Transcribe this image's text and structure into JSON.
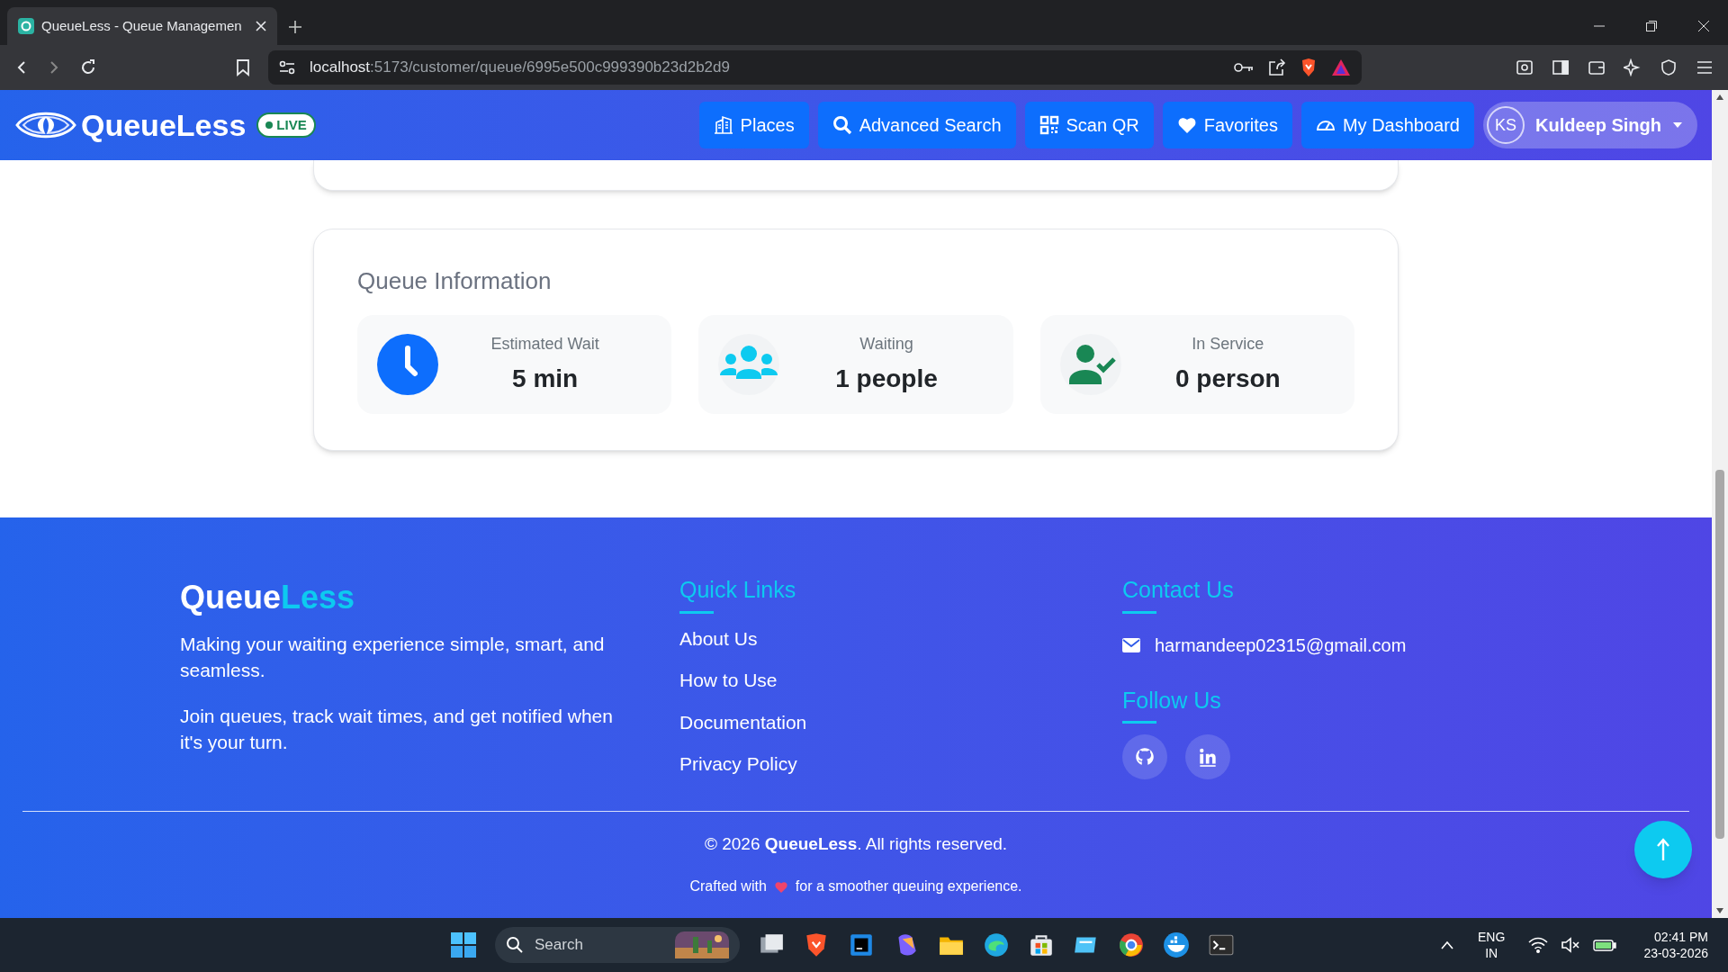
{
  "browser": {
    "tab_title": "QueueLess - Queue Managemen",
    "url_host": "localhost",
    "url_rest": ":5173/customer/queue/6995e500c999390b23d2b2d9"
  },
  "navbar": {
    "brand": "QueueLess",
    "live_badge": "LIVE",
    "items": [
      {
        "label": "Places",
        "kind": "building"
      },
      {
        "label": "Advanced Search",
        "kind": "search"
      },
      {
        "label": "Scan QR",
        "kind": "qr"
      },
      {
        "label": "Favorites",
        "kind": "heart"
      },
      {
        "label": "My Dashboard",
        "kind": "gauge"
      }
    ],
    "user": {
      "initials": "KS",
      "name": "Kuldeep Singh"
    }
  },
  "queue_info": {
    "title": "Queue Information",
    "stats": [
      {
        "kind": "clock",
        "label": "Estimated Wait",
        "value": "5 min"
      },
      {
        "kind": "group",
        "label": "Waiting",
        "value": "1 people"
      },
      {
        "kind": "user-check",
        "label": "In Service",
        "value": "0 person"
      }
    ]
  },
  "footer": {
    "brand_first": "Queue",
    "brand_second": "Less",
    "taglines": [
      "Making your waiting experience simple, smart, and seamless.",
      "Join queues, track wait times, and get notified when it's your turn."
    ],
    "quick_links": {
      "title": "Quick Links",
      "links": [
        "About Us",
        "How to Use",
        "Documentation",
        "Privacy Policy"
      ]
    },
    "contact": {
      "title": "Contact Us",
      "email": "harmandeep02315@gmail.com"
    },
    "follow": {
      "title": "Follow Us",
      "socials": [
        {
          "kind": "github"
        },
        {
          "kind": "linkedin"
        }
      ]
    },
    "copyright": "© 2026 **QueueLess**. All rights reserved.",
    "crafted_before": "Crafted with",
    "crafted_after": "for a smoother queuing experience."
  },
  "taskbar": {
    "search": "Search",
    "lang": "ENG",
    "region": "IN",
    "time": "02:41 PM",
    "date": "23-03-2026"
  }
}
